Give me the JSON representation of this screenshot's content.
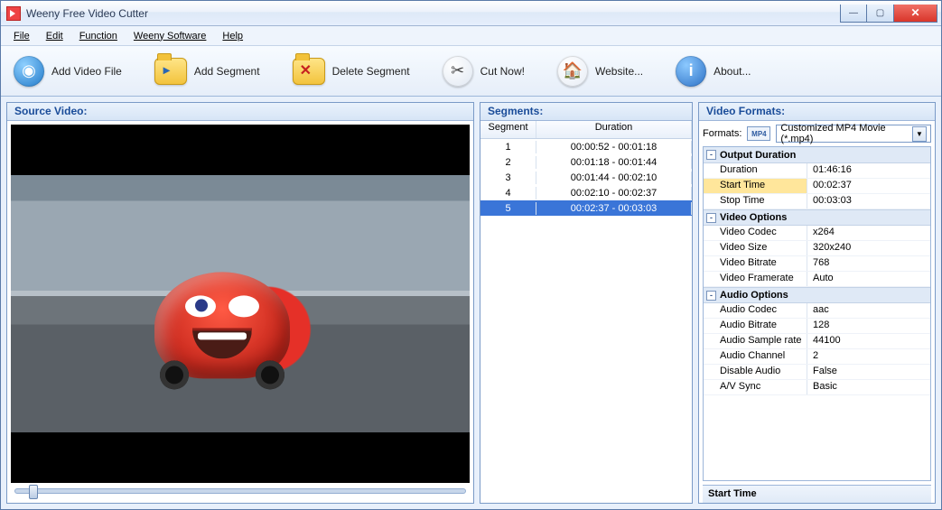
{
  "window": {
    "title": "Weeny Free Video Cutter"
  },
  "menu": {
    "file": "File",
    "edit": "Edit",
    "function": "Function",
    "weeny": "Weeny Software",
    "help": "Help"
  },
  "toolbar": {
    "add_file": "Add Video File",
    "add_segment": "Add Segment",
    "delete_segment": "Delete Segment",
    "cut_now": "Cut Now!",
    "website": "Website...",
    "about": "About..."
  },
  "panels": {
    "source": "Source Video:",
    "segments": "Segments:",
    "formats": "Video Formats:"
  },
  "segments": {
    "headers": {
      "segment": "Segment",
      "duration": "Duration"
    },
    "rows": [
      {
        "n": "1",
        "d": "00:00:52 - 00:01:18"
      },
      {
        "n": "2",
        "d": "00:01:18 - 00:01:44"
      },
      {
        "n": "3",
        "d": "00:01:44 - 00:02:10"
      },
      {
        "n": "4",
        "d": "00:02:10 - 00:02:37"
      },
      {
        "n": "5",
        "d": "00:02:37 - 00:03:03"
      }
    ],
    "selected_index": 4
  },
  "formats": {
    "label": "Formats:",
    "badge": "MP4",
    "selected": "Customized MP4 Movie (*.mp4)",
    "sections": {
      "output_duration": {
        "title": "Output Duration",
        "rows": [
          {
            "k": "Duration",
            "v": "01:46:16",
            "hl": false
          },
          {
            "k": "Start Time",
            "v": "00:02:37",
            "hl": true
          },
          {
            "k": "Stop Time",
            "v": "00:03:03",
            "hl": false
          }
        ]
      },
      "video_options": {
        "title": "Video Options",
        "rows": [
          {
            "k": "Video Codec",
            "v": "x264"
          },
          {
            "k": "Video Size",
            "v": "320x240"
          },
          {
            "k": "Video Bitrate",
            "v": "768"
          },
          {
            "k": "Video Framerate",
            "v": "Auto"
          }
        ]
      },
      "audio_options": {
        "title": "Audio Options",
        "rows": [
          {
            "k": "Audio Codec",
            "v": "aac"
          },
          {
            "k": "Audio Bitrate",
            "v": "128"
          },
          {
            "k": "Audio Sample rate",
            "v": "44100"
          },
          {
            "k": "Audio Channel",
            "v": "2"
          },
          {
            "k": "Disable Audio",
            "v": "False"
          },
          {
            "k": "A/V Sync",
            "v": "Basic"
          }
        ]
      }
    },
    "footer": "Start Time"
  }
}
